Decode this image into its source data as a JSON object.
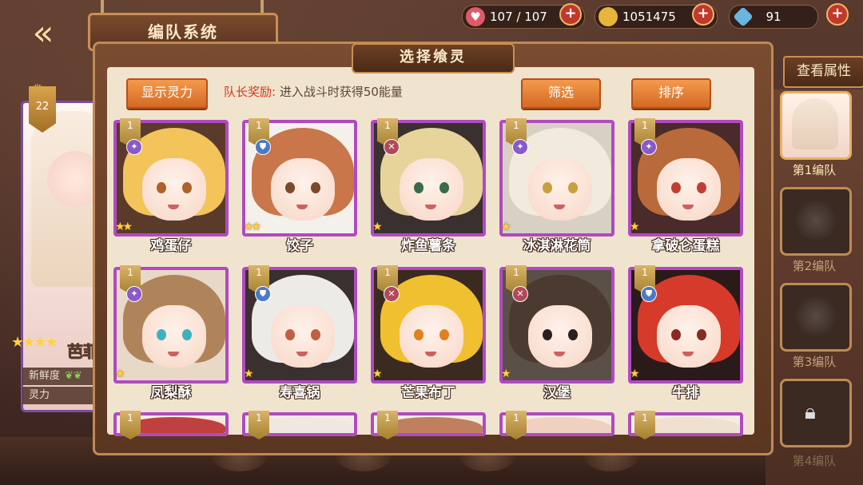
{
  "header": {
    "back_icon": "back-arrow-icon",
    "title": "编队系统"
  },
  "resources": [
    {
      "name": "stamina",
      "icon": "heart-icon",
      "value": "107 / 107",
      "color": "#e05a6a"
    },
    {
      "name": "gold",
      "icon": "coin-icon",
      "value": "1051475",
      "color": "#e8b43a"
    },
    {
      "name": "gem",
      "icon": "crystal-icon",
      "value": "91",
      "color": "#6ab4e0"
    }
  ],
  "panel": {
    "title": "选择飨灵",
    "show_power_label": "显示灵力",
    "leader_bonus_label": "队长奖励:",
    "leader_bonus_text": "进入战斗时获得50能量",
    "filter_label": "筛选",
    "sort_label": "排序"
  },
  "left_character": {
    "level": "22",
    "name": "芭菲",
    "stars": "★★★★",
    "freshness_label": "新鲜度",
    "power_label": "灵力"
  },
  "right_panel": {
    "view_attributes_label": "查看属性",
    "teams": [
      {
        "label": "第1编队",
        "active": true
      },
      {
        "label": "第2编队",
        "active": false
      },
      {
        "label": "第3编队",
        "active": false
      },
      {
        "label": "第4编队",
        "active": false
      }
    ]
  },
  "cards": [
    {
      "name": "鸡蛋仔",
      "level": "1",
      "stars": "★★",
      "type": "star",
      "hair": "#f2c45a",
      "bg": "#5a3a2a",
      "eye": "#b0602a"
    },
    {
      "name": "饺子",
      "level": "1",
      "stars": "★★",
      "type": "shield",
      "hair": "#c8764a",
      "bg": "#f4f0ec",
      "eye": "#7a4a2a"
    },
    {
      "name": "炸鱼薯条",
      "level": "1",
      "stars": "★",
      "type": "sword",
      "hair": "#e6d49a",
      "bg": "#3a3030",
      "eye": "#3a6a4a"
    },
    {
      "name": "冰淇淋花筒",
      "level": "1",
      "stars": "★",
      "type": "star",
      "hair": "#f2eadc",
      "bg": "#d8d0c4",
      "eye": "#c8a040"
    },
    {
      "name": "拿破仑蛋糕",
      "level": "1",
      "stars": "★",
      "type": "star",
      "hair": "#b86a3a",
      "bg": "#4a2a2a",
      "eye": "#c04030"
    },
    {
      "name": "凤梨酥",
      "level": "1",
      "stars": "★",
      "type": "star",
      "hair": "#b0845a",
      "bg": "#e8d8c8",
      "eye": "#40b0c0"
    },
    {
      "name": "寿喜锅",
      "level": "1",
      "stars": "★",
      "type": "shield",
      "hair": "#ecebe8",
      "bg": "#3a3030",
      "eye": "#c06040"
    },
    {
      "name": "芒果布丁",
      "level": "1",
      "stars": "★",
      "type": "sword",
      "hair": "#f0c030",
      "bg": "#3a2a20",
      "eye": "#e08020"
    },
    {
      "name": "汉堡",
      "level": "1",
      "stars": "★",
      "type": "sword",
      "hair": "#4a3a30",
      "bg": "#5a5048",
      "eye": "#2a2020"
    },
    {
      "name": "牛排",
      "level": "1",
      "stars": "★",
      "type": "shield",
      "hair": "#d63a2a",
      "bg": "#2a1a1a",
      "eye": "#8a2a20"
    }
  ],
  "bottom_cards": [
    {
      "level": "1",
      "hair": "#c04040"
    },
    {
      "level": "1",
      "hair": "#f0e8e0"
    },
    {
      "level": "1",
      "hair": "#c08060"
    },
    {
      "level": "1",
      "hair": "#f0d0c0"
    },
    {
      "level": "1",
      "hair": "#f0e0d0"
    }
  ]
}
